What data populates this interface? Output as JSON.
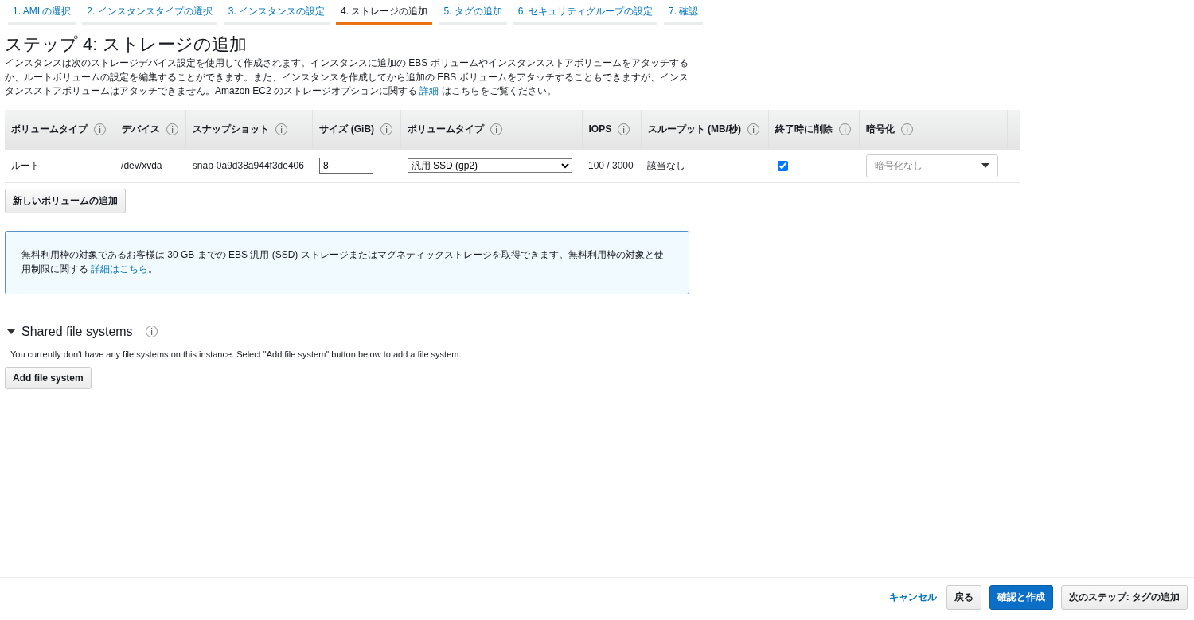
{
  "tabs": [
    {
      "label": "1. AMI の選択",
      "selected": false
    },
    {
      "label": "2. インスタンスタイプの選択",
      "selected": false
    },
    {
      "label": "3. インスタンスの設定",
      "selected": false
    },
    {
      "label": "4. ストレージの追加",
      "selected": true
    },
    {
      "label": "5. タグの追加",
      "selected": false
    },
    {
      "label": "6. セキュリティグループの設定",
      "selected": false
    },
    {
      "label": "7. 確認",
      "selected": false
    }
  ],
  "title": "ステップ 4: ストレージの追加",
  "description": {
    "before": "インスタンスは次のストレージデバイス設定を使用して作成されます。インスタンスに追加の EBS ボリュームやインスタンスストアボリュームをアタッチするか、ルートボリュームの設定を編集することができます。また、インスタンスを作成してから追加の EBS ボリュームをアタッチすることもできますが、インスタンスストアボリュームはアタッチできません。Amazon EC2 のストレージオプションに関する",
    "link": "詳細",
    "after": "はこちらをご覧ください。"
  },
  "table": {
    "columns": [
      "ボリュームタイプ",
      "デバイス",
      "スナップショット",
      "サイズ (GiB)",
      "ボリュームタイプ",
      "IOPS",
      "スループット (MB/秒)",
      "終了時に削除",
      "暗号化"
    ],
    "rows": [
      {
        "volume": "ルート",
        "device": "/dev/xvda",
        "snapshot": "snap-0a9d38a944f3de406",
        "size": "8",
        "type": "汎用 SSD (gp2)",
        "iops": "100 / 3000",
        "throughput": "該当なし",
        "delete_on_termination": true,
        "encryption_placeholder": "暗号化なし"
      }
    ]
  },
  "add_volume_button": "新しいボリュームの追加",
  "info_box": {
    "text": "無料利用枠の対象であるお客様は 30 GB までの EBS 汎用 (SSD) ストレージまたはマグネティックストレージを取得できます。無料利用枠の対象と使用制限に関する",
    "link": "詳細はこちら",
    "after": "。"
  },
  "shared_fs": {
    "title": "Shared file systems",
    "expanded": true,
    "message": "You currently don't have any file systems on this instance. Select \"Add file system\" button below to add a file system.",
    "button": "Add file system"
  },
  "footer": {
    "cancel": "キャンセル",
    "back": "戻る",
    "review": "確認と作成",
    "next": "次のステップ: タグの追加"
  }
}
